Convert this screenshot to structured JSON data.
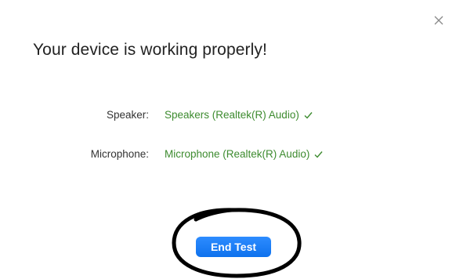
{
  "dialog": {
    "close_icon": "close-icon",
    "heading": "Your device is working properly!",
    "speaker": {
      "label": "Speaker:",
      "value": "Speakers (Realtek(R) Audio)",
      "status_icon": "check-icon"
    },
    "microphone": {
      "label": "Microphone:",
      "value": "Microphone (Realtek(R) Audio)",
      "status_icon": "check-icon"
    },
    "end_test_label": "End Test"
  },
  "colors": {
    "ok_green": "#3d8b2f",
    "button_blue": "#0e72ed",
    "annotation_black": "#000000"
  }
}
